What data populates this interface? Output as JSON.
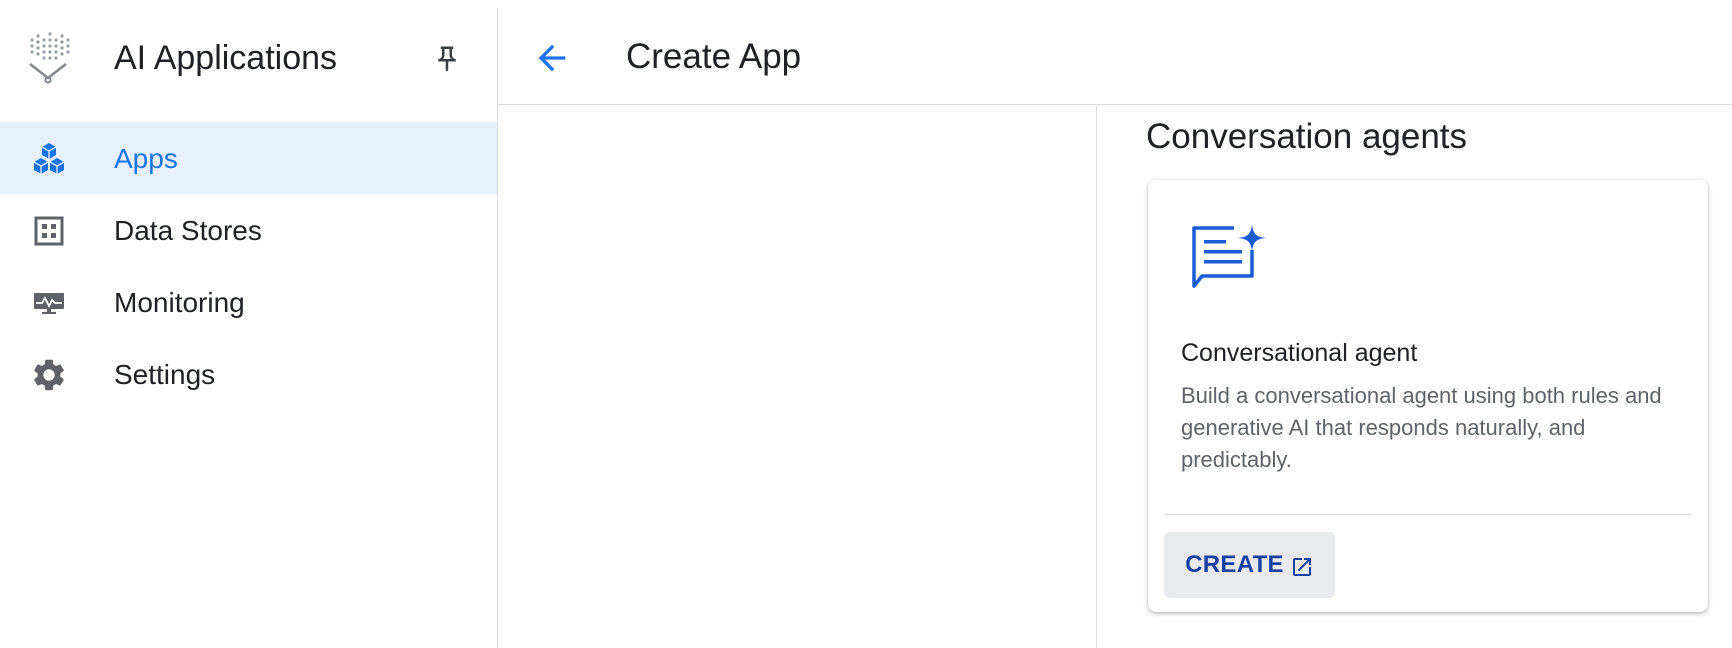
{
  "sidebar": {
    "title": "AI Applications",
    "items": [
      {
        "label": "Apps",
        "icon": "apps-cubes-icon",
        "active": true
      },
      {
        "label": "Data Stores",
        "icon": "data-stores-icon",
        "active": false
      },
      {
        "label": "Monitoring",
        "icon": "monitoring-icon",
        "active": false
      },
      {
        "label": "Settings",
        "icon": "gear-icon",
        "active": false
      }
    ]
  },
  "header": {
    "title": "Create App"
  },
  "main": {
    "section_title": "Conversation agents",
    "card": {
      "title": "Conversational agent",
      "description": "Build a conversational agent using both rules and generative AI that responds naturally, and predictably.",
      "create_label": "CREATE"
    }
  },
  "colors": {
    "accent": "#1a73e8",
    "active_bg": "#e8f0fe",
    "icon_gray": "#5f6368",
    "button_text": "#1a3fa3",
    "button_bg": "#e8eaed"
  }
}
